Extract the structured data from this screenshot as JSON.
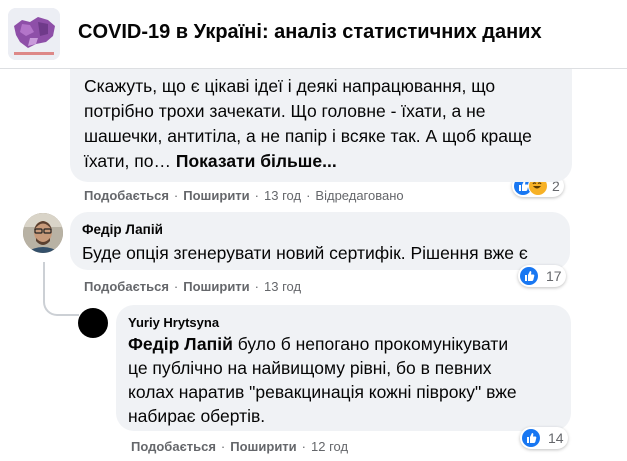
{
  "header": {
    "group_title": "COVID-19 в Україні: аналіз статистичних даних"
  },
  "comment1": {
    "text_lines": [
      "Скажуть, що є цікаві ідеї і деякі напрацювання, що",
      "потрібно трохи зачекати. Що головне - їхати, а не",
      "шашечки, антитіла, а не папір і всяке так. А щоб краще",
      "їхати, по…"
    ],
    "see_more": "Показати більше...",
    "like_label": "Подобається",
    "share_label": "Поширити",
    "time": "13 год",
    "edited": "Відредаговано",
    "reaction_count": "2"
  },
  "comment2": {
    "author": "Федір Лапій",
    "text": "Буде опція згенерувати новий сертифік. Рішення вже є",
    "like_label": "Подобається",
    "share_label": "Поширити",
    "time": "13 год",
    "reaction_count": "17"
  },
  "comment3": {
    "author": "Yuriy Hrytsyna",
    "mention": "Федір Лапій",
    "text_lines": [
      " було б непогано прокомунікувати",
      "це публічно на найвищому рівні, бо в певних",
      "колах наратив \"ревакцинація кожні півроку\" вже",
      "набирає обертів."
    ],
    "like_label": "Подобається",
    "share_label": "Поширити",
    "time": "12 год",
    "reaction_count": "14"
  },
  "colors": {
    "bubble": "#f0f2f5",
    "meta_text": "#65676b",
    "like_blue": "#1877f2",
    "haha_yellow": "#f7b125"
  }
}
